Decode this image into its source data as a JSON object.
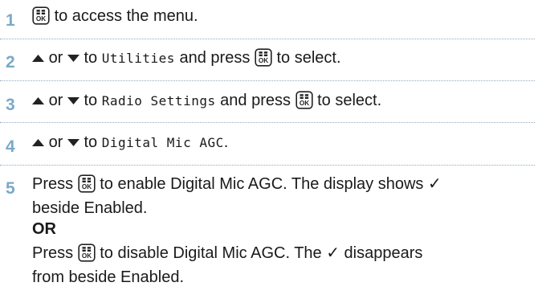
{
  "steps": [
    {
      "number": "1",
      "text_a": "to access the menu."
    },
    {
      "number": "2",
      "or": "or",
      "to": "to",
      "target": "Utilities",
      "press": "and press",
      "select": "to select."
    },
    {
      "number": "3",
      "or": "or",
      "to": "to",
      "target": "Radio Settings",
      "press": "and press",
      "select": "to select."
    },
    {
      "number": "4",
      "or": "or",
      "to": "to",
      "target": "Digital Mic AGC",
      "end": "."
    },
    {
      "number": "5",
      "press1": "Press",
      "line1": "to enable Digital Mic AGC. The display shows ✓",
      "line2": "beside Enabled.",
      "or_label": "OR",
      "press2": "Press",
      "line4": "to disable Digital Mic AGC. The ✓ disappears",
      "line5": "from beside Enabled."
    }
  ],
  "icons": {
    "ok_key": "ok-menu-key-icon",
    "up": "up-arrow-icon",
    "down": "down-arrow-icon"
  },
  "colors": {
    "step_number": "#7aa9c8",
    "separator": "#8fa9bf",
    "text": "#1a1a1a"
  }
}
